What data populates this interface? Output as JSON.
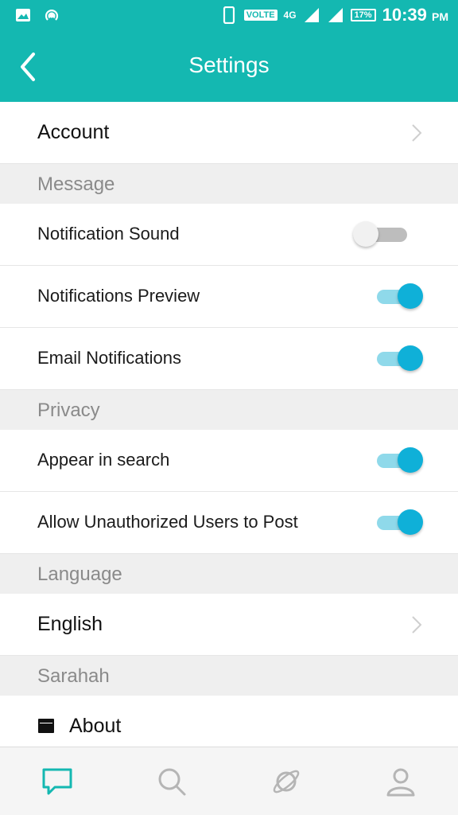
{
  "status_bar": {
    "volte": "VOLTE",
    "network": "4G",
    "battery": "17%",
    "time": "10:39",
    "ampm": "PM"
  },
  "app_bar": {
    "title": "Settings"
  },
  "rows": {
    "account": "Account",
    "section_message": "Message",
    "notification_sound": "Notification Sound",
    "notifications_preview": "Notifications Preview",
    "email_notifications": "Email Notifications",
    "section_privacy": "Privacy",
    "appear_in_search": "Appear in search",
    "allow_unauthorized": "Allow Unauthorized Users to Post",
    "section_language": "Language",
    "english": "English",
    "section_sarahah": "Sarahah",
    "about": "About"
  },
  "toggles": {
    "notification_sound": false,
    "notifications_preview": true,
    "email_notifications": true,
    "appear_in_search": true,
    "allow_unauthorized": true
  },
  "icons": {
    "nav": [
      "chat-bubble-icon",
      "search-icon",
      "planet-icon",
      "profile-icon"
    ]
  },
  "colors": {
    "accent": "#14b8b1",
    "toggle_on": "#0fb0d8"
  }
}
